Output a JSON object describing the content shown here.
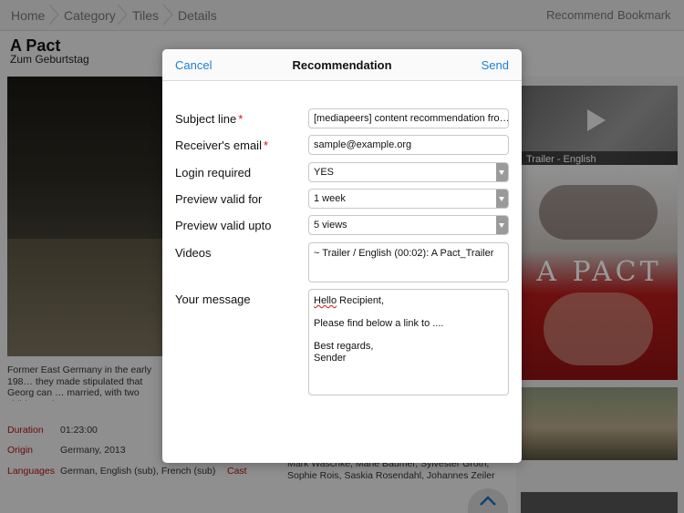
{
  "navbar": {
    "crumbs": [
      "Home",
      "Category",
      "Tiles",
      "Details"
    ],
    "recommend": "Recommend",
    "bookmark": "Bookmark"
  },
  "movie": {
    "title": "A Pact",
    "subtitle": "Zum Geburtstag",
    "synopsis": "Former East Germany in the early 198… they made stipulated that Georg can … married, with two children. Then Geo…",
    "meta": {
      "duration_label": "Duration",
      "duration_value": "01:23:00",
      "origin_label": "Origin",
      "origin_value": "Germany, 2013",
      "languages_label": "Languages",
      "languages_value": "German, English (sub), French (sub)",
      "cast_label": "Cast",
      "cast_value": "Mark Waschke, Marie Bäumer, Sylvester Groth, Sophie Rois, Saskia Rosendahl, Johannes Zeiler"
    }
  },
  "sidebar": {
    "trailer_caption": "Trailer - English",
    "poster_title": "A PACT"
  },
  "modal": {
    "cancel": "Cancel",
    "title": "Recommendation",
    "send": "Send",
    "fields": {
      "subject_label": "Subject line",
      "subject_value": "[mediapeers] content recommendation fro…",
      "receiver_label": "Receiver's email",
      "receiver_value": "sample@example.org",
      "login_label": "Login required",
      "login_value": "YES",
      "preview_for_label": "Preview valid for",
      "preview_for_value": "1 week",
      "preview_upto_label": "Preview valid upto",
      "preview_upto_value": "5 views",
      "videos_label": "Videos",
      "videos_value": "~ Trailer / English (00:02): A Pact_Trailer",
      "message_label": "Your message",
      "message_greeting_word": "Hello",
      "message_greeting_rest": " Recipient,",
      "message_line2": "Please find below a link to ....",
      "message_line3": "Best regards,",
      "message_line4": "Sender"
    },
    "required_mark": "*"
  }
}
